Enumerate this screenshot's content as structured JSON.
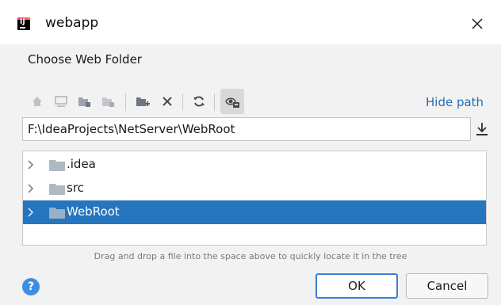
{
  "window": {
    "title": "webapp",
    "app_icon": "intellij-idea-icon",
    "close_icon": "close-icon"
  },
  "dialog": {
    "header": "Choose Web Folder"
  },
  "toolbar": {
    "buttons": [
      {
        "icon": "home-icon",
        "enabled": false
      },
      {
        "icon": "desktop-icon",
        "enabled": false
      },
      {
        "icon": "project-folder-icon",
        "enabled": false
      },
      {
        "icon": "module-folder-icon",
        "enabled": false
      },
      {
        "icon": "new-folder-icon",
        "enabled": true
      },
      {
        "icon": "delete-icon",
        "enabled": true
      },
      {
        "icon": "refresh-icon",
        "enabled": true
      },
      {
        "icon": "show-hidden-files-icon",
        "enabled": true,
        "active": true
      }
    ],
    "hide_path_label": "Hide path"
  },
  "path": {
    "value": "F:\\IdeaProjects\\NetServer\\WebRoot",
    "download_icon": "download-icon"
  },
  "tree": {
    "items": [
      {
        "label": ".idea",
        "selected": false
      },
      {
        "label": "src",
        "selected": false
      },
      {
        "label": "WebRoot",
        "selected": true
      }
    ]
  },
  "hint": "Drag and drop a file into the space above to quickly locate it in the tree",
  "buttons": {
    "help_label": "?",
    "ok_label": "OK",
    "cancel_label": "Cancel"
  },
  "colors": {
    "accent": "#2675bf",
    "link": "#2470b3",
    "help": "#3d8ee0"
  }
}
